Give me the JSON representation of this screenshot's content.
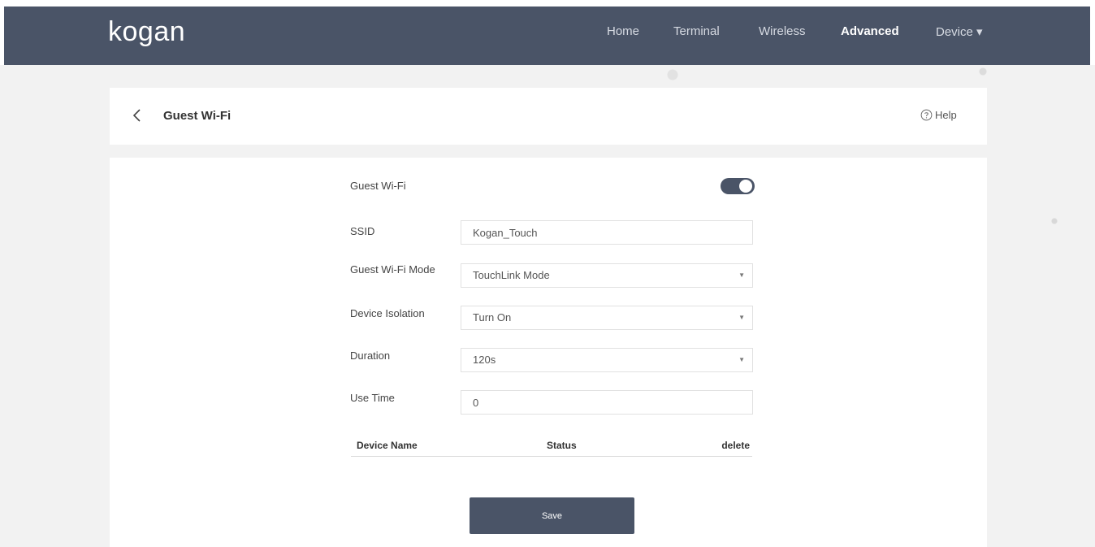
{
  "brand": {
    "logo_text": "kogan"
  },
  "nav": {
    "home": "Home",
    "terminal": "Terminal",
    "wireless": "Wireless",
    "advanced": "Advanced",
    "device": "Device ▾"
  },
  "header": {
    "title": "Guest Wi-Fi",
    "help": "Help"
  },
  "form": {
    "guest_wifi_label": "Guest Wi-Fi",
    "guest_wifi_enabled": true,
    "ssid_label": "SSID",
    "ssid_value": "Kogan_Touch",
    "mode_label": "Guest Wi-Fi Mode",
    "mode_value": "TouchLink Mode",
    "isolation_label": "Device Isolation",
    "isolation_value": "Turn On",
    "duration_label": "Duration",
    "duration_value": "120s",
    "use_time_label": "Use Time",
    "use_time_value": "0"
  },
  "table": {
    "columns": [
      "Device Name",
      "Status",
      "delete"
    ]
  },
  "actions": {
    "save_label": "Save"
  },
  "colors": {
    "navbar": "#4a5467",
    "accent": "#4a5467",
    "background": "#f2f2f2"
  }
}
